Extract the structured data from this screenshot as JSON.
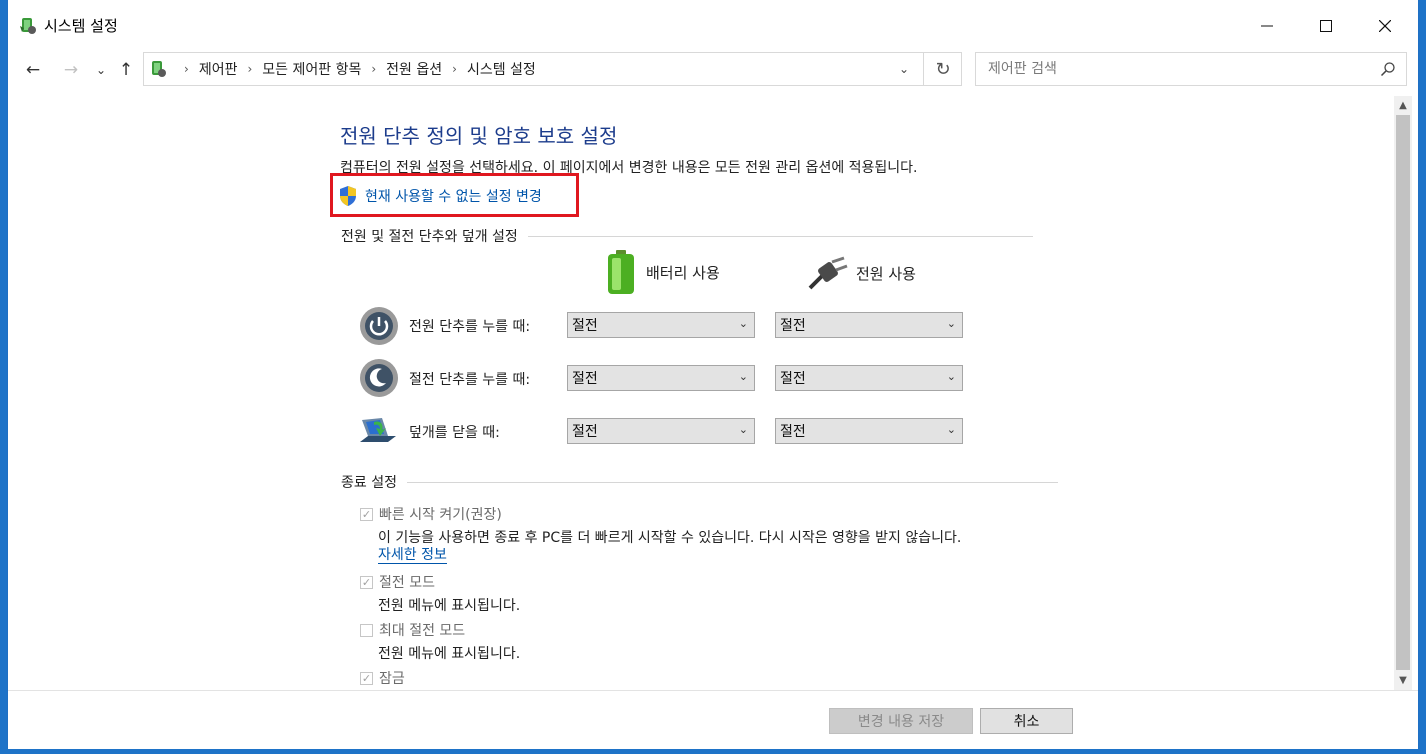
{
  "window": {
    "title": "시스템 설정",
    "controls": {
      "minimize": "—",
      "maximize": "☐",
      "close": "✕"
    }
  },
  "nav": {
    "breadcrumbs": [
      "제어판",
      "모든 제어판 항목",
      "전원 옵션",
      "시스템 설정"
    ],
    "search_placeholder": "제어판 검색"
  },
  "page": {
    "title": "전원 단추 정의 및 암호 보호 설정",
    "description": "컴퓨터의 전원 설정을 선택하세요. 이 페이지에서 변경한 내용은 모든 전원 관리 옵션에 적용됩니다.",
    "admin_link": "현재 사용할 수 없는 설정 변경"
  },
  "power_section": {
    "header": "전원 및 절전 단추와 덮개 설정",
    "col_battery": "배터리 사용",
    "col_plugged": "전원 사용",
    "rows": [
      {
        "label": "전원 단추를 누를 때:",
        "battery": "절전",
        "plugged": "절전"
      },
      {
        "label": "절전 단추를 누를 때:",
        "battery": "절전",
        "plugged": "절전"
      },
      {
        "label": "덮개를 닫을 때:",
        "battery": "절전",
        "plugged": "절전"
      }
    ]
  },
  "shutdown_section": {
    "header": "종료 설정",
    "options": [
      {
        "title": "빠른 시작 켜기(권장)",
        "checked": true,
        "desc": "이 기능을 사용하면 종료 후 PC를 더 빠르게 시작할 수 있습니다. 다시 시작은 영향을 받지 않습니다.",
        "link": "자세한 정보"
      },
      {
        "title": "절전 모드",
        "checked": true,
        "desc": "전원 메뉴에 표시됩니다."
      },
      {
        "title": "최대 절전 모드",
        "checked": false,
        "desc": "전원 메뉴에 표시됩니다."
      },
      {
        "title": "잠금",
        "checked": true
      }
    ]
  },
  "footer": {
    "save_label": "변경 내용 저장",
    "cancel_label": "취소"
  },
  "colors": {
    "title_blue": "#1c3c8c",
    "link_blue": "#0055aa",
    "highlight_red": "#e0171f",
    "desktop_blue": "#1e73c8"
  },
  "icons": {
    "app": "power-options-icon",
    "admin": "uac-shield-icon",
    "battery": "battery-icon",
    "plugged": "power-plug-icon",
    "power_button": "power-button-icon",
    "sleep_button": "sleep-button-icon",
    "lid": "laptop-lid-icon"
  }
}
